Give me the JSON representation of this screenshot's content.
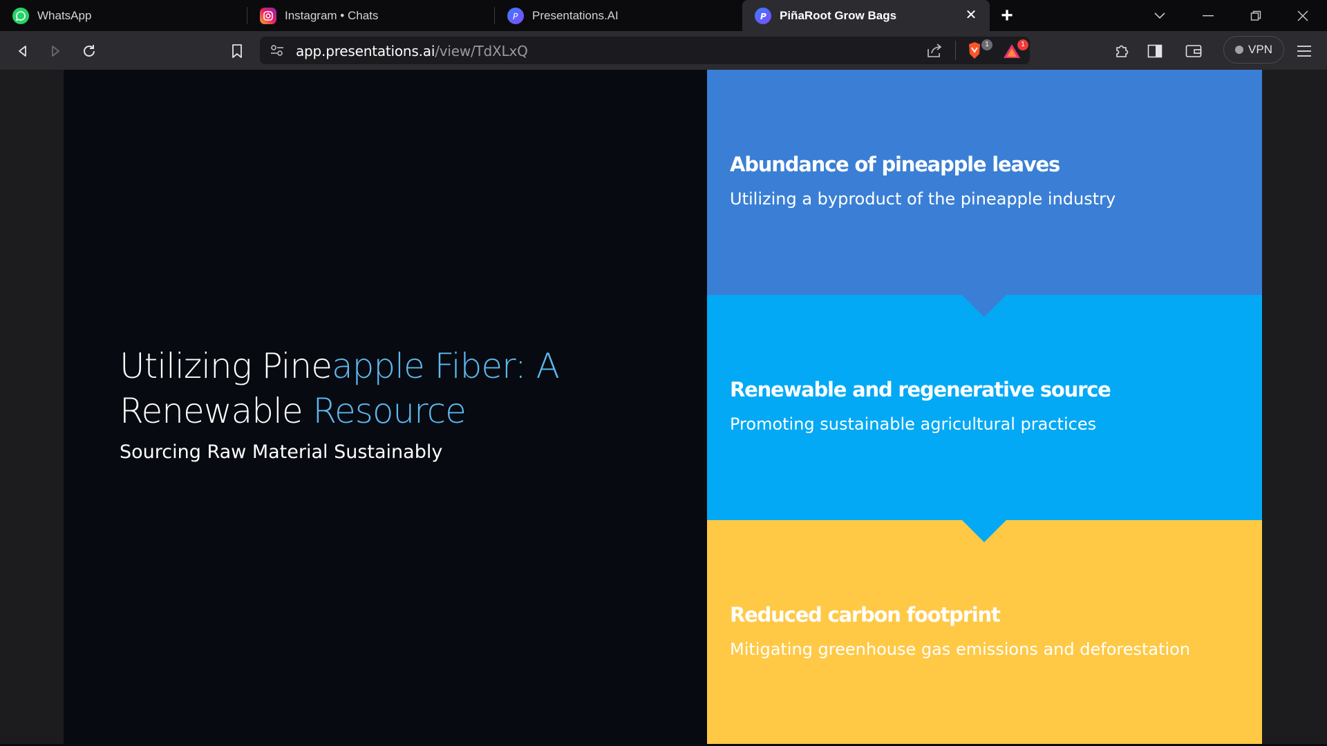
{
  "tabs": [
    {
      "label": "WhatsApp",
      "icon": "whatsapp-icon"
    },
    {
      "label": "Instagram • Chats",
      "icon": "instagram-icon"
    },
    {
      "label": "Presentations.AI",
      "icon": "presentations-ai-icon"
    },
    {
      "label": "PiñaRoot Grow Bags",
      "icon": "presentations-ai-icon",
      "active": true
    }
  ],
  "addressbar": {
    "domain": "app.presentations.ai",
    "path": "/view/TdXLxQ"
  },
  "badges": {
    "brave_count": "1",
    "rewards_count": "1"
  },
  "vpn_label": "VPN",
  "slide": {
    "title_parts": [
      "Utilizing Pine",
      "apple Fiber: A",
      "Renewable ",
      "Resource"
    ],
    "subtitle": "Sourcing Raw Material Sustainably",
    "cards": [
      {
        "heading": "Abundance of pineapple leaves",
        "text": "Utilizing a byproduct of the pineapple industry",
        "color": "#3a7fd5"
      },
      {
        "heading": "Renewable and regenerative source",
        "text": "Promoting sustainable agricultural practices",
        "color": "#03a9f4"
      },
      {
        "heading": "Reduced carbon footprint",
        "text": "Mitigating greenhouse gas emissions and deforestation",
        "color": "#ffc946"
      }
    ]
  },
  "colors": {
    "accent_text": "#5eb8ef",
    "slide_bg": "#070a10"
  }
}
